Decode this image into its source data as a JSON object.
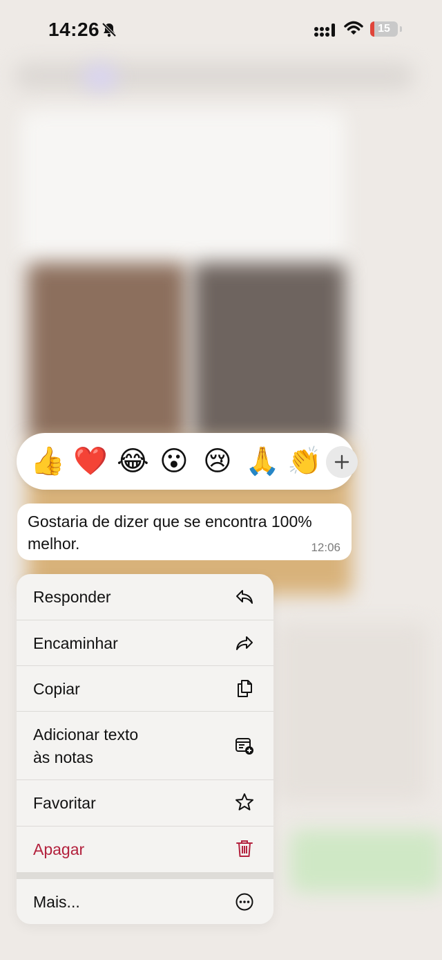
{
  "status_bar": {
    "time": "14:26",
    "battery_level": "15",
    "icons": [
      "bell-slash-icon",
      "signal-icon",
      "wifi-icon",
      "battery-icon"
    ]
  },
  "reactions": {
    "emojis": [
      "👍",
      "❤️",
      "😂",
      "😮",
      "😢",
      "🙏",
      "👏"
    ],
    "more_icon": "plus-icon"
  },
  "message": {
    "text": "Gostaria de dizer que se encontra 100% melhor.",
    "time": "12:06"
  },
  "menu": {
    "items": [
      {
        "label": "Responder",
        "icon": "reply-icon"
      },
      {
        "label": "Encaminhar",
        "icon": "forward-icon"
      },
      {
        "label": "Copiar",
        "icon": "copy-icon"
      },
      {
        "label": "Adicionar texto às notas",
        "line1": "Adicionar texto",
        "line2": "às notas",
        "icon": "add-note-icon"
      },
      {
        "label": "Favoritar",
        "icon": "star-icon"
      },
      {
        "label": "Apagar",
        "icon": "trash-icon",
        "color": "#b3213d"
      },
      {
        "label": "Mais...",
        "icon": "more-icon"
      }
    ]
  },
  "colors": {
    "danger": "#b3213d",
    "battery_low": "#e0453a"
  }
}
